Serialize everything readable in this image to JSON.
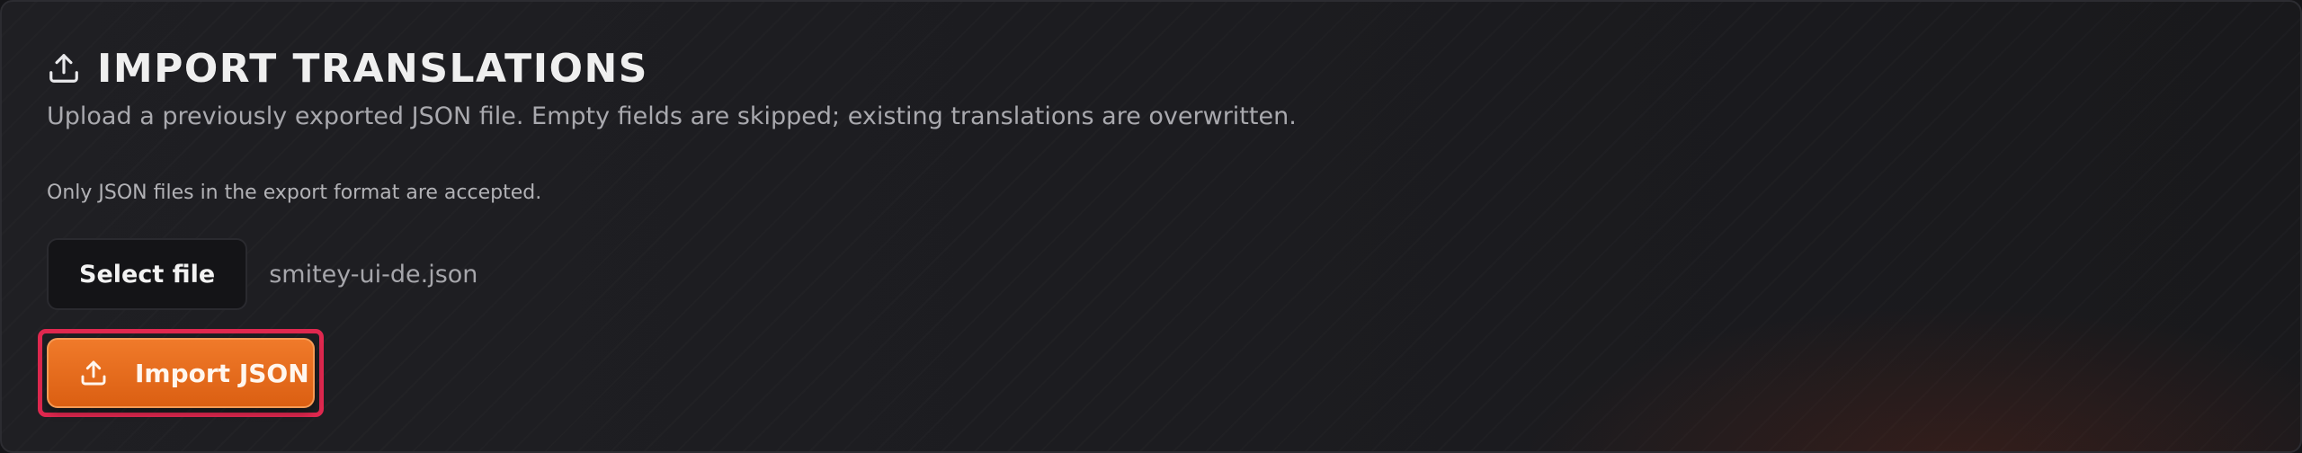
{
  "card": {
    "title": "IMPORT TRANSLATIONS",
    "title_icon": "upload-icon",
    "description": "Upload a previously exported JSON file. Empty fields are skipped; existing translations are overwritten.",
    "note": "Only JSON files in the export format are accepted."
  },
  "file_picker": {
    "button_label": "Select file",
    "selected_file": "smitey-ui-de.json"
  },
  "import_button": {
    "label": "Import JSON",
    "icon": "upload-icon"
  },
  "colors": {
    "accent": "#e8671c",
    "highlight": "#e0284f",
    "background": "#1e1e22"
  }
}
